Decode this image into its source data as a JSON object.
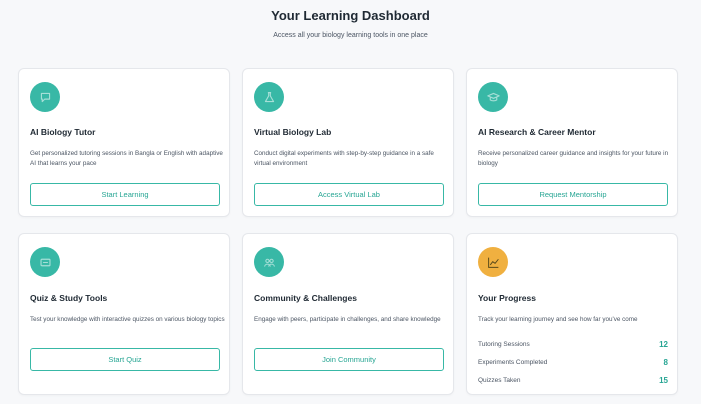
{
  "header": {
    "title": "Your Learning Dashboard",
    "subtitle": "Access all your biology learning tools in one place"
  },
  "cards": [
    {
      "title": "AI Biology Tutor",
      "description": "Get personalized tutoring sessions in Bangla or English with adaptive AI that learns your pace",
      "button": "Start Learning",
      "icon": "chat-bubble-icon"
    },
    {
      "title": "Virtual Biology Lab",
      "description": "Conduct digital experiments with step-by-step guidance in a safe virtual environment",
      "button": "Access Virtual Lab",
      "icon": "flask-icon"
    },
    {
      "title": "AI Research & Career Mentor",
      "description": "Receive personalized career guidance and insights for your future in biology",
      "button": "Request Mentorship",
      "icon": "graduation-cap-icon"
    },
    {
      "title": "Quiz & Study Tools",
      "description": "Test your knowledge with interactive quizzes on various biology topics",
      "button": "Start Quiz",
      "icon": "quiz-card-icon"
    },
    {
      "title": "Community & Challenges",
      "description": "Engage with peers, participate in challenges, and share knowledge",
      "button": "Join Community",
      "icon": "community-icon"
    }
  ],
  "progress": {
    "title": "Your Progress",
    "description": "Track your learning journey and see how far you've come",
    "icon": "line-chart-icon",
    "stats": [
      {
        "label": "Tutoring Sessions",
        "value": "12"
      },
      {
        "label": "Experiments Completed",
        "value": "8"
      },
      {
        "label": "Quizzes Taken",
        "value": "15"
      }
    ]
  },
  "colors": {
    "accent": "#38b8a6",
    "accent_text": "#26a593",
    "progress_icon": "#f0b040"
  }
}
